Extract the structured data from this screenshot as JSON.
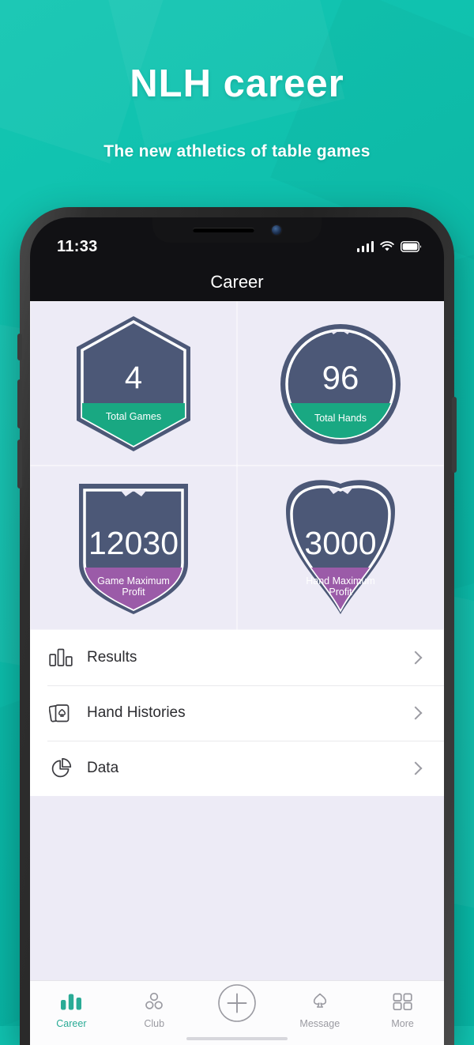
{
  "promo": {
    "headline": "NLH career",
    "subhead": "The new athletics of table games",
    "background_color": "#10c2b0"
  },
  "phone": {
    "status_bar": {
      "time": "11:33",
      "signal_icon": "cellular-signal-icon",
      "wifi_icon": "wifi-icon",
      "battery_icon": "battery-icon"
    },
    "nav_title": "Career"
  },
  "stats": {
    "background_color": "#edebf6",
    "body_color": "#4c5877",
    "teal_color": "#19a882",
    "purple_color": "#9b5ba8",
    "badges": [
      {
        "shape": "hexagon",
        "value": "4",
        "label": "Total Games",
        "banner_color": "#19a882"
      },
      {
        "shape": "circle",
        "value": "96",
        "label": "Total Hands",
        "banner_color": "#19a882"
      },
      {
        "shape": "shield",
        "value": "12030",
        "label": "Game Maximum Profit",
        "banner_color": "#9b5ba8"
      },
      {
        "shape": "heart-shield",
        "value": "3000",
        "label": "Hand Maximum Profit",
        "banner_color": "#9b5ba8"
      }
    ]
  },
  "menu": {
    "items": [
      {
        "label": "Results",
        "icon": "bar-chart-icon",
        "chevron": "chevron-right-icon"
      },
      {
        "label": "Hand Histories",
        "icon": "playing-cards-icon",
        "chevron": "chevron-right-icon"
      },
      {
        "label": "Data",
        "icon": "pie-chart-icon",
        "chevron": "chevron-right-icon"
      }
    ]
  },
  "tabbar": {
    "active_color": "#2aab96",
    "inactive_color": "#9a9aa1",
    "tabs": [
      {
        "label": "Career",
        "icon": "bar-chart-icon",
        "active": true
      },
      {
        "label": "Club",
        "icon": "people-circles-icon",
        "active": false
      },
      {
        "label": "",
        "icon": "plus-circle-icon",
        "active": false
      },
      {
        "label": "Message",
        "icon": "spade-icon",
        "active": false
      },
      {
        "label": "More",
        "icon": "grid-squares-icon",
        "active": false
      }
    ]
  }
}
